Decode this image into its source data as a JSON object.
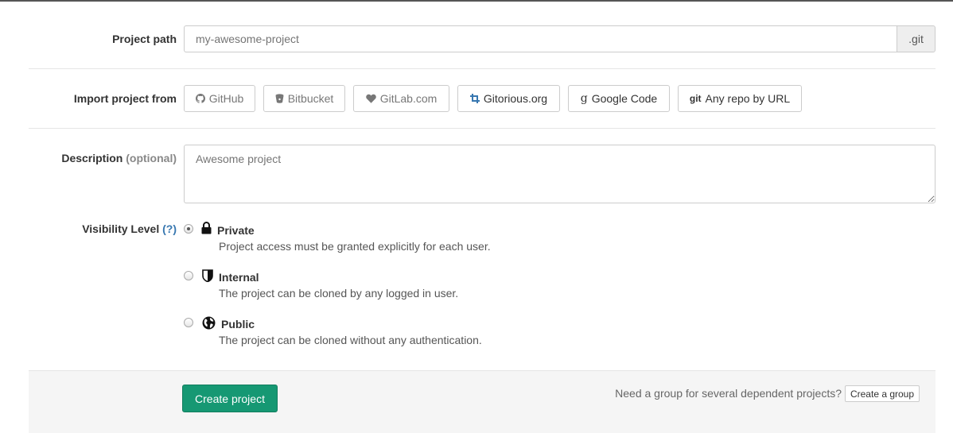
{
  "project_path": {
    "label": "Project path",
    "placeholder": "my-awesome-project",
    "suffix": ".git"
  },
  "import": {
    "label": "Import project from",
    "sources": [
      {
        "label": "GitHub",
        "icon": "github-icon"
      },
      {
        "label": "Bitbucket",
        "icon": "bitbucket-icon"
      },
      {
        "label": "GitLab.com",
        "icon": "heart-icon"
      },
      {
        "label": "Gitorious.org",
        "icon": "crop-icon"
      },
      {
        "label": "Google Code",
        "icon": "google-icon"
      },
      {
        "label": "Any repo by URL",
        "icon": "git-icon",
        "icon_text": "git"
      }
    ]
  },
  "description": {
    "label": "Description",
    "optional": "(optional)",
    "placeholder": "Awesome project"
  },
  "visibility": {
    "label": "Visibility Level",
    "help": "(?)",
    "options": [
      {
        "title": "Private",
        "description": "Project access must be granted explicitly for each user.",
        "icon": "lock-icon",
        "checked": true
      },
      {
        "title": "Internal",
        "description": "The project can be cloned by any logged in user.",
        "icon": "shield-icon",
        "checked": false
      },
      {
        "title": "Public",
        "description": "The project can be cloned without any authentication.",
        "icon": "globe-icon",
        "checked": false
      }
    ]
  },
  "footer": {
    "create_label": "Create project",
    "hint": "Need a group for several dependent projects?",
    "group_label": "Create a group"
  },
  "colors": {
    "primary_button": "#169873",
    "help_link": "#3777b0"
  }
}
